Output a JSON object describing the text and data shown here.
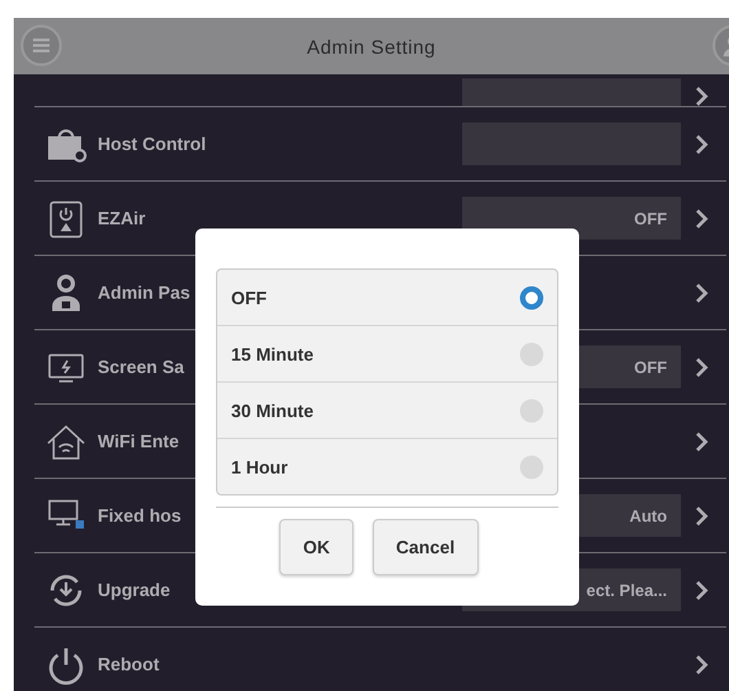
{
  "header": {
    "title": "Admin Setting"
  },
  "rows": [
    {
      "kind": "box",
      "label": "Host Control"
    },
    {
      "kind": "box",
      "label": "EZAir",
      "value": "OFF"
    },
    {
      "kind": "plain",
      "label": "Admin Pas"
    },
    {
      "kind": "box",
      "label": "Screen Sa",
      "value": "OFF"
    },
    {
      "kind": "plain",
      "label": "WiFi Ente"
    },
    {
      "kind": "box",
      "label": "Fixed hos",
      "value": "Auto"
    },
    {
      "kind": "box",
      "label": "Upgrade",
      "value": "ect. Plea..."
    },
    {
      "kind": "plain",
      "label": "Reboot"
    }
  ],
  "dialog": {
    "options": [
      {
        "label": "OFF",
        "selected": true
      },
      {
        "label": "15 Minute",
        "selected": false
      },
      {
        "label": "30 Minute",
        "selected": false
      },
      {
        "label": "1 Hour",
        "selected": false
      }
    ],
    "buttons": [
      "OK",
      "Cancel"
    ]
  }
}
